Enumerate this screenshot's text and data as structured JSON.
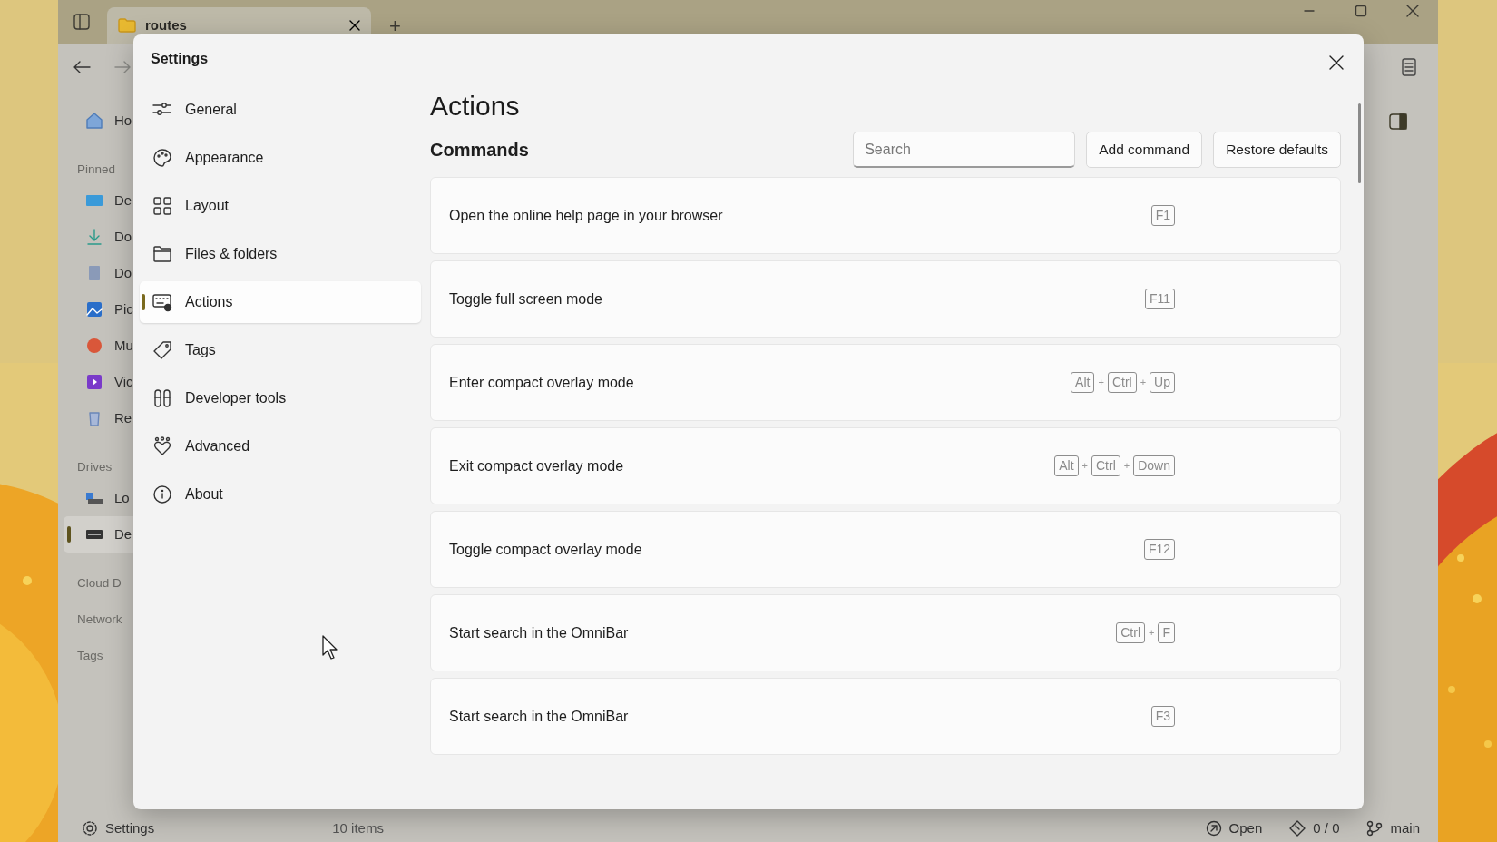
{
  "window": {
    "tabs": [
      {
        "label": "routes",
        "selected": true
      }
    ],
    "new_tab": "+"
  },
  "sidebar": [
    {
      "kind": "item",
      "label": "Ho",
      "selected": false
    },
    {
      "kind": "heading",
      "label": "Pinned"
    },
    {
      "kind": "item",
      "label": "De",
      "selected": false
    },
    {
      "kind": "item",
      "label": "Do",
      "selected": false
    },
    {
      "kind": "item",
      "label": "Do",
      "selected": false
    },
    {
      "kind": "item",
      "label": "Pic",
      "selected": false
    },
    {
      "kind": "item",
      "label": "Mu",
      "selected": false
    },
    {
      "kind": "item",
      "label": "Vic",
      "selected": false
    },
    {
      "kind": "item",
      "label": "Re",
      "selected": false
    },
    {
      "kind": "heading",
      "label": "Drives"
    },
    {
      "kind": "item",
      "label": "Lo",
      "selected": false
    },
    {
      "kind": "item",
      "label": "De",
      "selected": true
    },
    {
      "kind": "heading",
      "label": "Cloud D"
    },
    {
      "kind": "heading",
      "label": "Network"
    },
    {
      "kind": "heading",
      "label": "Tags"
    }
  ],
  "status_bar": {
    "settings": "Settings",
    "count": "10 items",
    "right": [
      "Open",
      "0 / 0",
      "main"
    ]
  },
  "dialog": {
    "title": "Settings",
    "nav": [
      {
        "label": "General",
        "selected": false
      },
      {
        "label": "Appearance",
        "selected": false
      },
      {
        "label": "Layout",
        "selected": false
      },
      {
        "label": "Files & folders",
        "selected": false
      },
      {
        "label": "Actions",
        "selected": true
      },
      {
        "label": "Tags",
        "selected": false
      },
      {
        "label": "Developer tools",
        "selected": false
      },
      {
        "label": "Advanced",
        "selected": false
      },
      {
        "label": "About",
        "selected": false
      }
    ],
    "page_title": "Actions",
    "section_title": "Commands",
    "search": {
      "placeholder": "Search"
    },
    "buttons": [
      "Add command",
      "Restore defaults"
    ],
    "commands": [
      {
        "label": "Open the online help page in your browser",
        "shortcut": [
          {
            "kind": "key",
            "text": "F1"
          }
        ]
      },
      {
        "label": "Toggle full screen mode",
        "shortcut": [
          {
            "kind": "key",
            "text": "F11"
          }
        ]
      },
      {
        "label": "Enter compact overlay mode",
        "shortcut": [
          {
            "kind": "key",
            "text": "Alt"
          },
          {
            "kind": "plus",
            "text": "+"
          },
          {
            "kind": "key",
            "text": "Ctrl"
          },
          {
            "kind": "plus",
            "text": "+"
          },
          {
            "kind": "key",
            "text": "Up"
          }
        ]
      },
      {
        "label": "Exit compact overlay mode",
        "shortcut": [
          {
            "kind": "key",
            "text": "Alt"
          },
          {
            "kind": "plus",
            "text": "+"
          },
          {
            "kind": "key",
            "text": "Ctrl"
          },
          {
            "kind": "plus",
            "text": "+"
          },
          {
            "kind": "key",
            "text": "Down"
          }
        ]
      },
      {
        "label": "Toggle compact overlay mode",
        "shortcut": [
          {
            "kind": "key",
            "text": "F12"
          }
        ]
      },
      {
        "label": "Start search in the OmniBar",
        "shortcut": [
          {
            "kind": "key",
            "text": "Ctrl"
          },
          {
            "kind": "plus",
            "text": "+"
          },
          {
            "kind": "key",
            "text": "F"
          }
        ]
      },
      {
        "label": "Start search in the OmniBar",
        "shortcut": [
          {
            "kind": "key",
            "text": "F3"
          }
        ]
      }
    ]
  }
}
